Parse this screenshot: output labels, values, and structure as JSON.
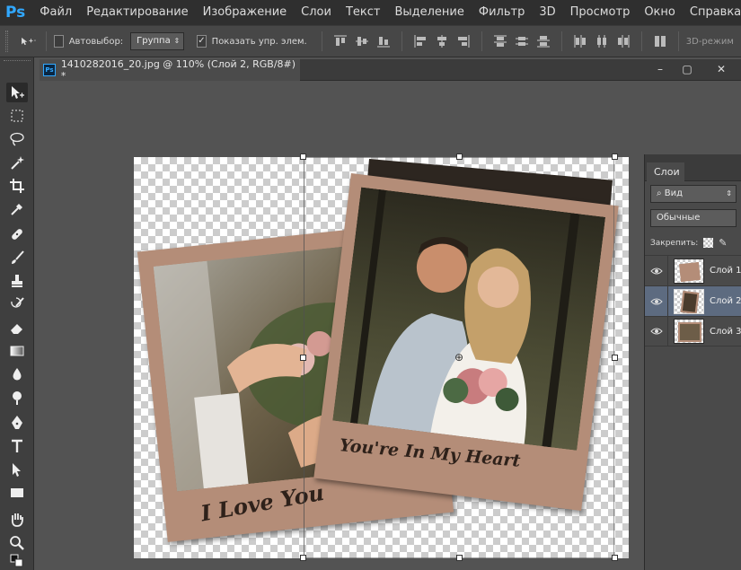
{
  "app": {
    "logo": "Ps"
  },
  "menu": [
    "Файл",
    "Редактирование",
    "Изображение",
    "Слои",
    "Текст",
    "Выделение",
    "Фильтр",
    "3D",
    "Просмотр",
    "Окно",
    "Справка"
  ],
  "options": {
    "auto_select_label": "Автовыбор:",
    "auto_select_value": "Группа",
    "show_transform_label": "Показать упр. элем.",
    "show_transform_checked": "✓",
    "mode_3d": "3D-режим"
  },
  "document": {
    "tab_title": "1410282016_20.jpg @ 110% (Слой 2, RGB/8#) *",
    "tab_icon": "Ps",
    "window_buttons": [
      "–",
      "▢",
      "✕"
    ]
  },
  "canvas": {
    "caption_left": "I Love You",
    "caption_right": "You're In My Heart"
  },
  "layers_panel": {
    "tab": "Слои",
    "filter_value": "Вид",
    "blend_mode": "Обычные",
    "lock_label": "Закрепить:",
    "layers": [
      {
        "name": "Слой 1",
        "selected": false
      },
      {
        "name": "Слой 2",
        "selected": true
      },
      {
        "name": "Слой 3",
        "selected": false
      }
    ]
  },
  "colors": {
    "accent": "#31a8ff",
    "selected_layer": "#5d6b80",
    "frame": "#b48d78"
  },
  "icons": [
    "move-tool-icon",
    "marquee-tool-icon",
    "lasso-tool-icon",
    "magic-wand-icon",
    "crop-tool-icon",
    "eyedropper-icon",
    "healing-brush-icon",
    "brush-tool-icon",
    "clone-stamp-icon",
    "history-brush-icon",
    "eraser-icon",
    "gradient-icon",
    "blur-icon",
    "dodge-icon",
    "pen-tool-icon",
    "type-tool-icon",
    "path-select-icon",
    "shape-tool-icon",
    "hand-tool-icon",
    "zoom-tool-icon",
    "eye-icon",
    "lock-icon",
    "brush-lock-icon"
  ]
}
